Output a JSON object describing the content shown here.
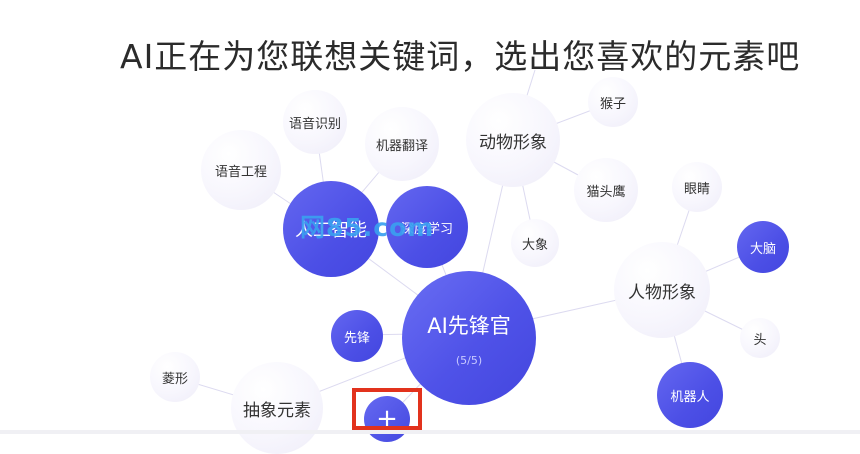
{
  "title": "AI正在为您联想关键词，选出您喜欢的元素吧",
  "hub": {
    "label": "AI先锋官",
    "count": "(5/5)"
  },
  "watermark": "网85.com",
  "add_button": {
    "label": "+"
  },
  "keywords": {
    "yuyin_shibie": "语音识别",
    "jiqi_fanyi": "机器翻译",
    "yuyin_gongcheng": "语音工程",
    "rengong_zhineng": "人工智能",
    "shendu_xuexi": "深度学习",
    "dongwu_xingxiang": "动物形象",
    "houzi": "猴子",
    "maotouying": "猫头鹰",
    "daxiang": "大象",
    "yanjing": "眼睛",
    "danao": "大脑",
    "renwu_xingxiang": "人物形象",
    "tou": "头",
    "jiqiren": "机器人",
    "xianfeng": "先锋",
    "lingxing": "菱形",
    "chouxiang_yuansu": "抽象元素"
  },
  "colors": {
    "accent": "#4f52e8",
    "highlight_box": "#e2321d",
    "watermark": "#3aa0f0"
  }
}
